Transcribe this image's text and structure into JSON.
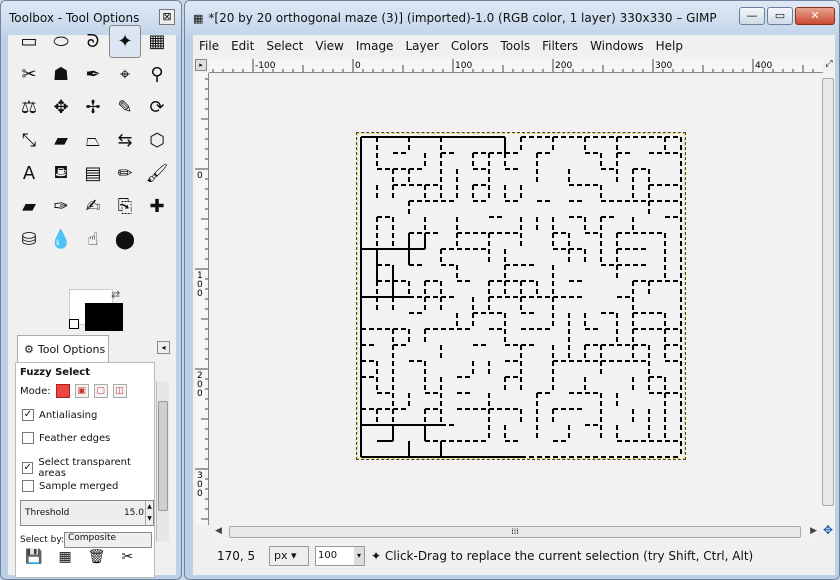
{
  "toolbox": {
    "title": "Toolbox - Tool Options",
    "close": "⊠",
    "tools": [
      {
        "name": "rect-select-icon",
        "glyph": "▭"
      },
      {
        "name": "ellipse-select-icon",
        "glyph": "⬭"
      },
      {
        "name": "free-select-icon",
        "glyph": "ᘐ"
      },
      {
        "name": "fuzzy-select-icon",
        "glyph": "✦",
        "active": true
      },
      {
        "name": "color-select-icon",
        "glyph": "▦"
      },
      {
        "name": "scissors-select-icon",
        "glyph": "✂"
      },
      {
        "name": "foreground-select-icon",
        "glyph": "☗"
      },
      {
        "name": "paths-icon",
        "glyph": "✒"
      },
      {
        "name": "color-picker-icon",
        "glyph": "⌖"
      },
      {
        "name": "zoom-icon",
        "glyph": "⚲"
      },
      {
        "name": "measure-icon",
        "glyph": "⚖"
      },
      {
        "name": "move-icon",
        "glyph": "✥"
      },
      {
        "name": "align-icon",
        "glyph": "✢"
      },
      {
        "name": "crop-icon",
        "glyph": "✎"
      },
      {
        "name": "rotate-icon",
        "glyph": "⟳"
      },
      {
        "name": "scale-icon",
        "glyph": "⤡"
      },
      {
        "name": "shear-icon",
        "glyph": "▰"
      },
      {
        "name": "perspective-icon",
        "glyph": "⏢"
      },
      {
        "name": "flip-icon",
        "glyph": "⇆"
      },
      {
        "name": "cage-icon",
        "glyph": "⬡"
      },
      {
        "name": "text-icon",
        "glyph": "A"
      },
      {
        "name": "bucket-fill-icon",
        "glyph": "⛾"
      },
      {
        "name": "blend-icon",
        "glyph": "▤"
      },
      {
        "name": "pencil-icon",
        "glyph": "✏"
      },
      {
        "name": "paintbrush-icon",
        "glyph": "🖌"
      },
      {
        "name": "eraser-icon",
        "glyph": "▰"
      },
      {
        "name": "airbrush-icon",
        "glyph": "✑"
      },
      {
        "name": "ink-icon",
        "glyph": "✍"
      },
      {
        "name": "clone-icon",
        "glyph": "⎘"
      },
      {
        "name": "heal-icon",
        "glyph": "✚"
      },
      {
        "name": "perspective-clone-icon",
        "glyph": "⛁"
      },
      {
        "name": "blur-icon",
        "glyph": "💧"
      },
      {
        "name": "smudge-icon",
        "glyph": "☝"
      },
      {
        "name": "dodge-burn-icon",
        "glyph": "⬤"
      }
    ],
    "tab_label": "Tool Options",
    "tab_menu": "◂",
    "options_title": "Fuzzy Select",
    "mode_label": "Mode:",
    "antialiasing": "Antialiasing",
    "feather_edges": "Feather edges",
    "select_transparent": "Select transparent areas",
    "sample_merged": "Sample merged",
    "threshold_label": "Threshold",
    "threshold_value": "15.0",
    "select_by_label": "Select by:",
    "select_by_value": "Composite",
    "checks": {
      "antialiasing": "✓",
      "feather": "",
      "transparent": "✓",
      "merged": ""
    },
    "bottom": [
      "💾",
      "▦",
      "🗑",
      "✂"
    ]
  },
  "image_window": {
    "title": "*[20 by 20 orthogonal maze (3)] (imported)-1.0 (RGB color, 1 layer) 330x330 – GIMP",
    "menus": [
      "File",
      "Edit",
      "Select",
      "View",
      "Image",
      "Layer",
      "Colors",
      "Tools",
      "Filters",
      "Windows",
      "Help"
    ],
    "ruler_h_labels": [
      "-100",
      "0",
      "100",
      "200",
      "300",
      "400"
    ],
    "ruler_v_labels": [
      "0",
      "100",
      "200",
      "300"
    ],
    "coords": "170, 5",
    "unit": "px ▾",
    "zoom": "100",
    "hint": "Click-Drag to replace the current selection (try Shift, Ctrl, Alt)",
    "minimize": "—",
    "maximize": "▭",
    "close": "✕"
  }
}
